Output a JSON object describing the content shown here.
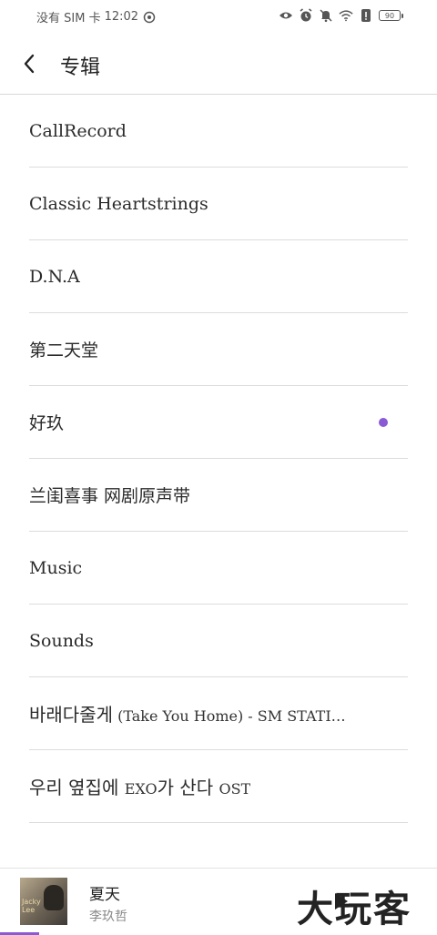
{
  "status_bar": {
    "carrier": "没有 SIM 卡",
    "time": "12:02",
    "battery": "90"
  },
  "header": {
    "title": "专辑"
  },
  "albums": [
    {
      "label": "CallRecord"
    },
    {
      "label": "Classic Heartstrings"
    },
    {
      "label": "D.N.A"
    },
    {
      "label": "第二天堂"
    },
    {
      "label": "好玖",
      "selected": true
    },
    {
      "label": "兰闺喜事 网剧原声带"
    },
    {
      "label": "Music"
    },
    {
      "label": "Sounds"
    },
    {
      "label_main": "바래다줄게",
      "label_suffix": " (Take You Home) - SM STATI…"
    },
    {
      "label_main": "우리 옆집에 ",
      "label_suffix": "EXO",
      "label_main2": "가 산다 ",
      "label_suffix2": "OST"
    }
  ],
  "now_playing": {
    "cover_text": "Jacky\nLee",
    "title": "夏天",
    "artist": "李玖哲",
    "watermark": "大玩客",
    "progress_fraction": 0.09
  },
  "colors": {
    "accent": "#8a5ad4",
    "divider": "#dcdcdc"
  }
}
